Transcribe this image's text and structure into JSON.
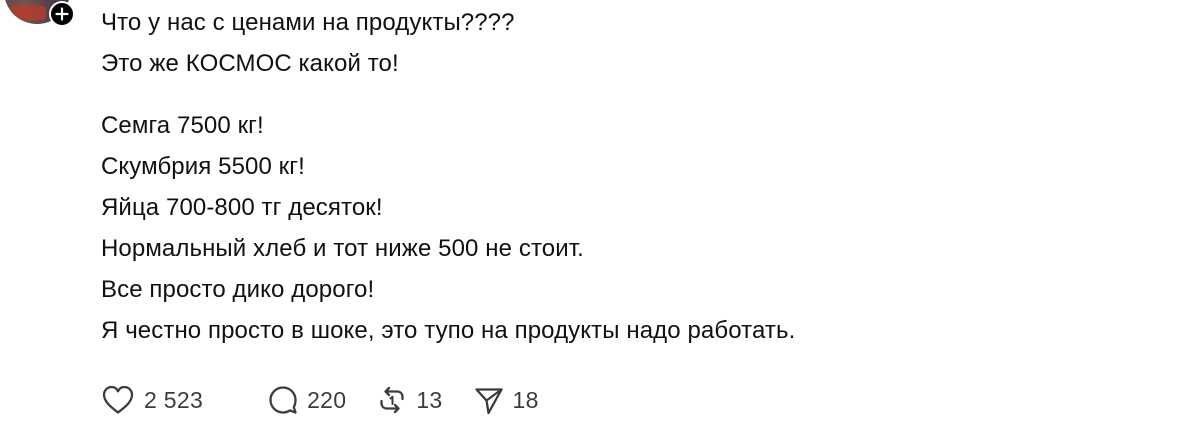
{
  "post": {
    "paragraphs": [
      [
        "Что у нас с ценами на продукты????",
        "Это же КОСМОС какой то!"
      ],
      [
        "Семга 7500 кг!",
        "Скумбрия 5500 кг!",
        "Яйца 700-800 тг десяток!",
        "Нормальный хлеб и тот ниже 500 не стоит.",
        "Все просто дико дорого!",
        "Я честно просто в шоке, это тупо на продукты надо работать."
      ]
    ]
  },
  "actions": {
    "like": {
      "icon": "heart-icon",
      "count": "2 523"
    },
    "reply": {
      "icon": "comment-icon",
      "count": "220"
    },
    "repost": {
      "icon": "repost-icon",
      "count": "13"
    },
    "share": {
      "icon": "send-icon",
      "count": "18"
    }
  },
  "avatar": {
    "badge_icon": "plus-icon"
  },
  "colors": {
    "text": "#111111",
    "muted": "#3c3c3c",
    "icon": "#3c3c3c",
    "badge": "#000000"
  }
}
